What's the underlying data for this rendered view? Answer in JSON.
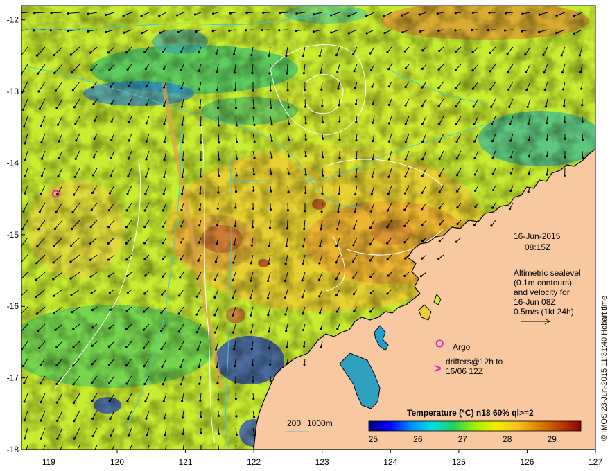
{
  "map": {
    "date": "16-Jun-2015",
    "time": "08:15Z",
    "altimetry_lines": [
      "Altimetric sealevel",
      "(0.1m contours)",
      "and velocity for",
      "16-Jun 08Z"
    ],
    "velocity_scale_label": "0.5m/s (1kt 24h)",
    "argo_label": "Argo",
    "drifters_lines": [
      "drifters@12h to",
      "16/06 12Z"
    ],
    "isobath_labels": [
      "200",
      "1000m"
    ],
    "side_credit": "© IMOS 23-Jun-2015 11:31:40 Hobart time",
    "x_ticks": [
      "119",
      "120",
      "121",
      "122",
      "123",
      "124",
      "125",
      "126",
      "127"
    ],
    "y_ticks": [
      "-12",
      "-13",
      "-14",
      "-15",
      "-16",
      "-17",
      "-18"
    ],
    "lon_range": [
      118.6,
      127.0
    ],
    "lat_range": [
      -18.0,
      -11.8
    ],
    "colors": {
      "land": "#f8c9a0",
      "coast": "#000000",
      "arrow": "#000000",
      "argo": "#e020c0",
      "isobath": "#40c8d8",
      "contour": "#ffffff"
    },
    "argo_floats": [
      {
        "lon": 119.1,
        "lat": -14.43
      },
      {
        "lon": 124.72,
        "lat": -16.52
      }
    ]
  },
  "colorbar": {
    "title": "Temperature (°C) n18 60% ql>=2",
    "ticks": [
      "25",
      "26",
      "27",
      "28",
      "29"
    ],
    "range": [
      24.9,
      29.65
    ],
    "stops": [
      "#00007a",
      "#0000ff",
      "#0090ff",
      "#00e0e0",
      "#20d060",
      "#a0f000",
      "#f0f000",
      "#f8c020",
      "#e08000",
      "#c04000",
      "#900000"
    ]
  }
}
